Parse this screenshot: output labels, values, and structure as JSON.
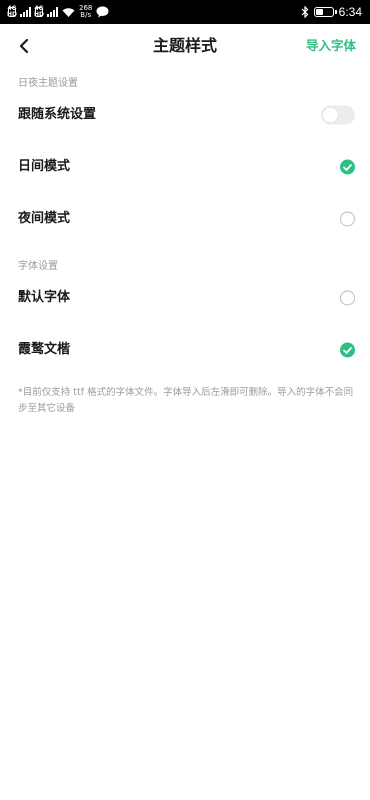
{
  "status_bar": {
    "sim1_tag_top": "4G",
    "sim1_tag_bottom": "HD",
    "sim2_tag_top": "4G",
    "sim2_tag_bottom": "HD",
    "sim1_net": "4G",
    "sim2_net": "4G",
    "net_speed_value": "268",
    "net_speed_unit": "B/s",
    "time": "6:34",
    "battery_level": 0.45,
    "icons": [
      "signal-icon",
      "wifi-icon",
      "chat-icon",
      "bluetooth-icon",
      "battery-icon"
    ]
  },
  "header": {
    "title": "主题样式",
    "import_label": "导入字体",
    "back_icon": "back-arrow-icon"
  },
  "theme_section": {
    "label": "日夜主题设置",
    "items": [
      {
        "label": "跟随系统设置",
        "control": "toggle",
        "on": false
      },
      {
        "label": "日间模式",
        "control": "radio",
        "selected": true
      },
      {
        "label": "夜间模式",
        "control": "radio",
        "selected": false
      }
    ]
  },
  "font_section": {
    "label": "字体设置",
    "items": [
      {
        "label": "默认字体",
        "control": "radio",
        "selected": false
      },
      {
        "label": "霞鹜文楷",
        "control": "radio",
        "selected": true
      }
    ]
  },
  "footnote": "*目前仅支持 ttf 格式的字体文件。字体导入后左滑即可删除。导入的字体不会同步至其它设备",
  "colors": {
    "accent": "#2fbf85",
    "muted_text": "#9a9a9a",
    "toggle_track": "#ececec"
  }
}
